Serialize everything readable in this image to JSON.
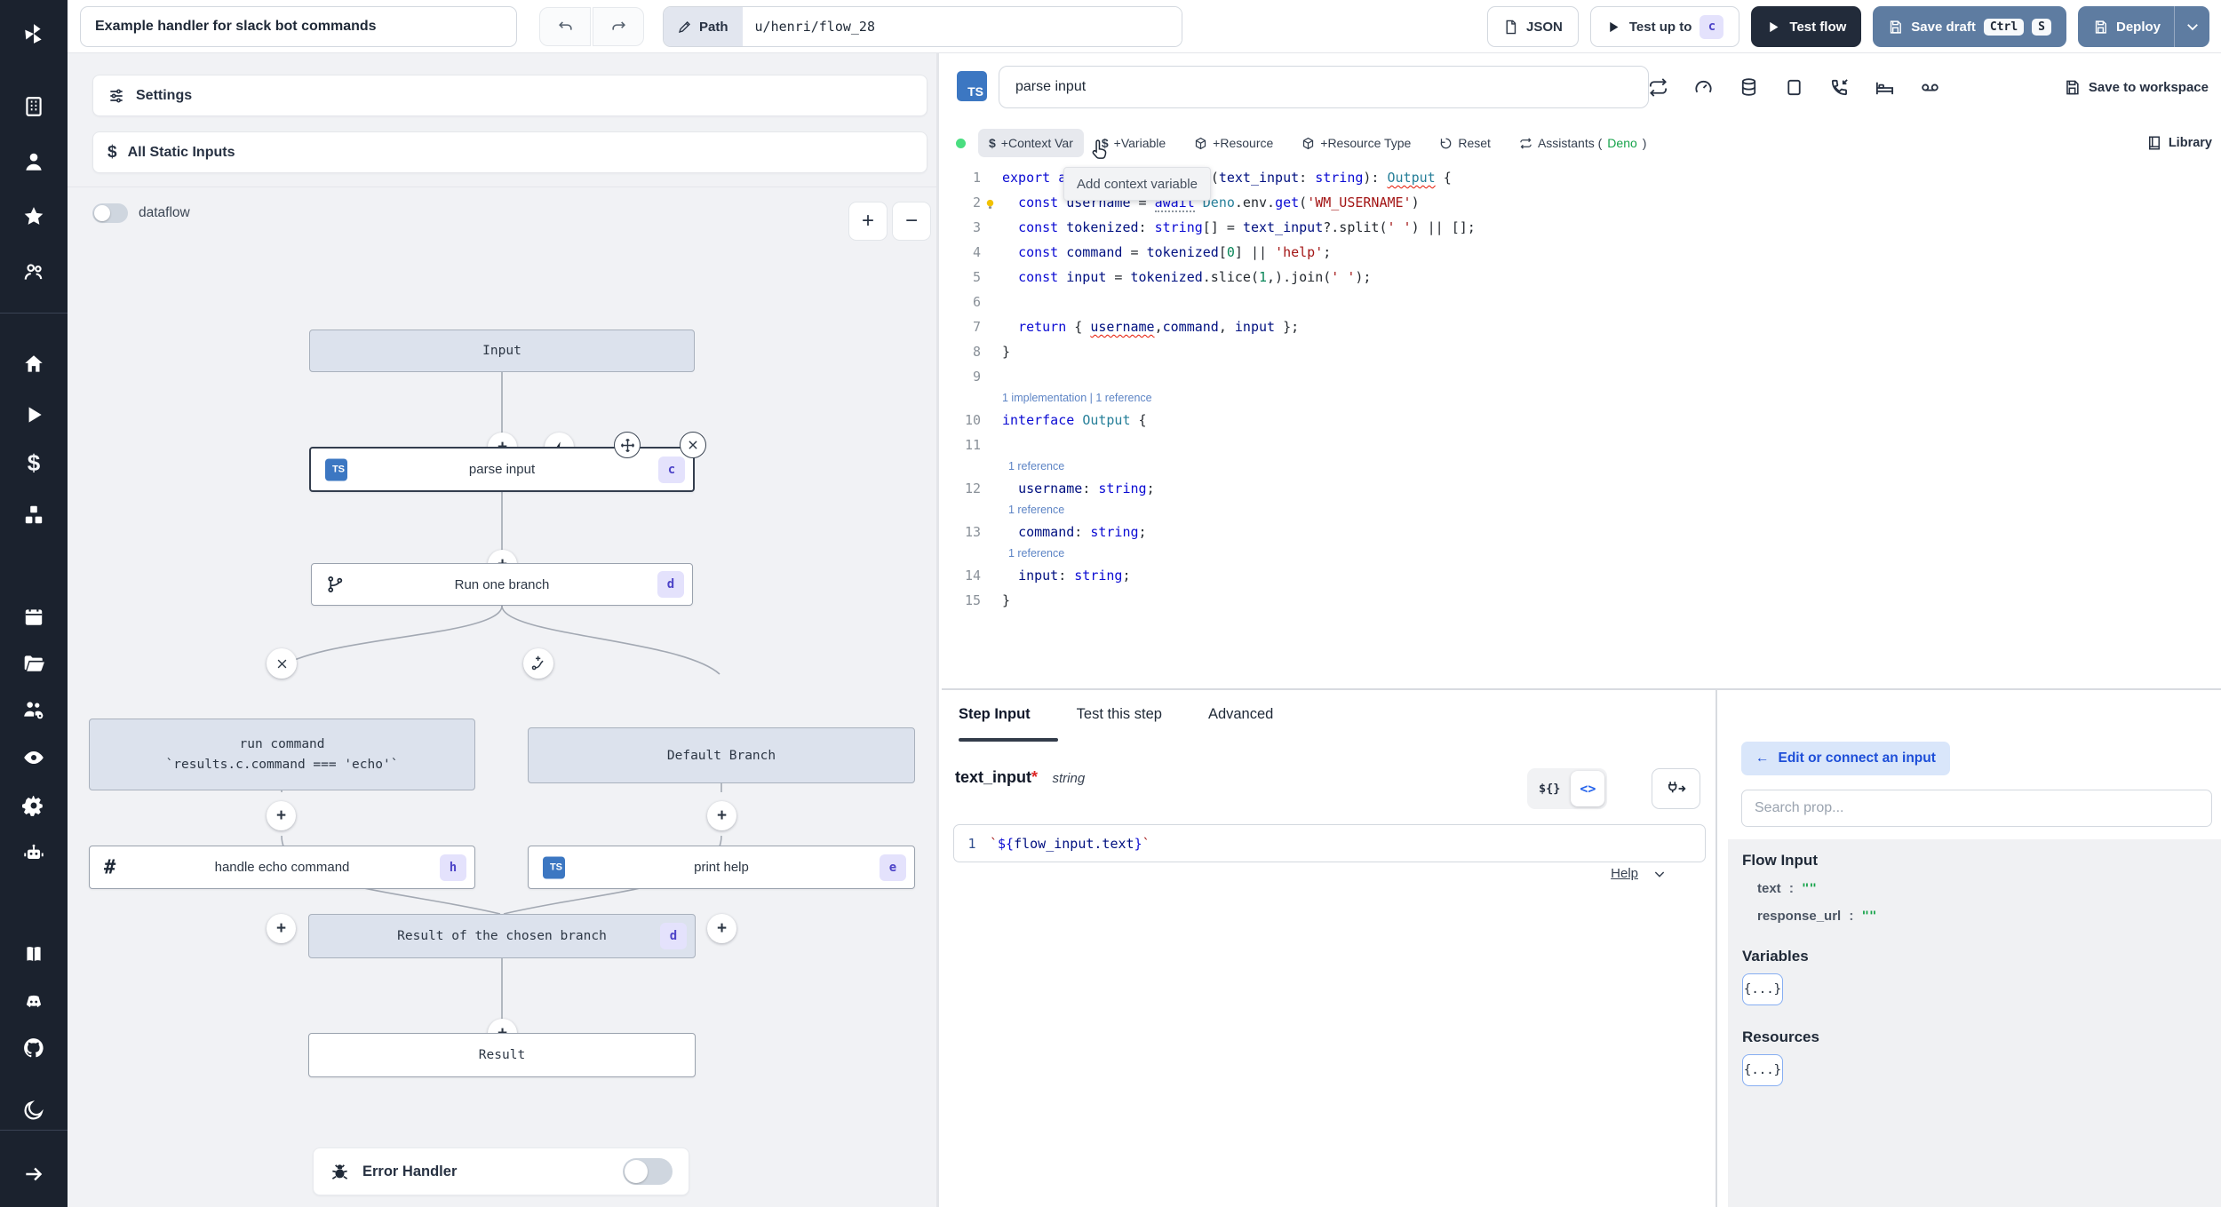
{
  "topbar": {
    "title": "Example handler for slack bot commands",
    "path_label": "Path",
    "path_value": "u/henri/flow_28",
    "json_label": "JSON",
    "test_up_to_label": "Test up to",
    "test_up_to_badge": "c",
    "test_flow_label": "Test flow",
    "save_draft_label": "Save draft",
    "save_draft_kbd_ctrl": "Ctrl",
    "save_draft_kbd_s": "S",
    "deploy_label": "Deploy"
  },
  "sidebar": {
    "icon_names": [
      "windmill-logo",
      "building",
      "user",
      "star",
      "users",
      "home",
      "play",
      "dollar",
      "cubes",
      "calendar",
      "folder",
      "users-gear",
      "eye",
      "gear",
      "robot",
      "book",
      "discord",
      "github",
      "moon",
      "arrow-right"
    ]
  },
  "flow": {
    "settings_label": "Settings",
    "all_static_inputs_label": "All Static Inputs",
    "dataflow_label": "dataflow",
    "zoom_in_label": "+",
    "zoom_out_label": "−",
    "nodes": {
      "input": {
        "label": "Input"
      },
      "parse_input": {
        "label": "parse input",
        "badge": "c"
      },
      "run_one_branch": {
        "label": "Run one branch",
        "badge": "d"
      },
      "run_command": {
        "label_line1": "run command",
        "label_line2": "`results.c.command === 'echo'`"
      },
      "default_branch": {
        "label": "Default Branch"
      },
      "handle_echo": {
        "label": "handle echo command",
        "badge": "h"
      },
      "print_help": {
        "label": "print help",
        "badge": "e"
      },
      "result_branch": {
        "label": "Result of the chosen branch",
        "badge": "d"
      },
      "result": {
        "label": "Result"
      }
    },
    "error_handler_label": "Error Handler"
  },
  "editor": {
    "lang_badge": "TS",
    "step_name": "parse input",
    "save_to_workspace_label": "Save to workspace",
    "toolbar": {
      "context_var": "+Context Var",
      "variable": "+Variable",
      "resource": "+Resource",
      "resource_type": "+Resource Type",
      "reset": "Reset",
      "assistants_prefix": "Assistants (",
      "assistants_lang": "Deno",
      "assistants_suffix": ")",
      "library": "Library"
    },
    "tooltip": "Add context variable",
    "code": {
      "lines": [
        {
          "type": "code",
          "n": "1",
          "tokens": [
            [
              "tk-k",
              "export async function "
            ],
            [
              "tk-m",
              "main"
            ],
            [
              "tk-p",
              "("
            ],
            [
              "tk-v",
              "text_input"
            ],
            [
              "tk-p",
              ": "
            ],
            [
              "tk-k",
              "string"
            ],
            [
              "tk-p",
              "): "
            ],
            [
              "tk-t sq",
              "Output"
            ],
            [
              "tk-p",
              " {"
            ]
          ]
        },
        {
          "type": "code",
          "n": "2",
          "tokens": [
            [
              "tk-p",
              "  "
            ],
            [
              "tk-k",
              "const "
            ],
            [
              "tk-v",
              "username"
            ],
            [
              "tk-p",
              " = "
            ],
            [
              "tk-k hint",
              "await"
            ],
            [
              "tk-p",
              " "
            ],
            [
              "tk-t",
              "Deno"
            ],
            [
              "tk-p",
              ".env."
            ],
            [
              "tk-k",
              "get"
            ],
            [
              "tk-p",
              "("
            ],
            [
              "tk-s",
              "'WM_USERNAME'"
            ],
            [
              "tk-p",
              ")"
            ]
          ]
        },
        {
          "type": "code",
          "n": "3",
          "tokens": [
            [
              "tk-p",
              "  "
            ],
            [
              "tk-k",
              "const "
            ],
            [
              "tk-v",
              "tokenized"
            ],
            [
              "tk-p",
              ": "
            ],
            [
              "tk-k",
              "string"
            ],
            [
              "tk-p",
              "[] = "
            ],
            [
              "tk-v",
              "text_input"
            ],
            [
              "tk-p",
              "?.split("
            ],
            [
              "tk-s",
              "' '"
            ],
            [
              "tk-p",
              ") || [];"
            ]
          ]
        },
        {
          "type": "code",
          "n": "4",
          "tokens": [
            [
              "tk-p",
              "  "
            ],
            [
              "tk-k",
              "const "
            ],
            [
              "tk-v",
              "command"
            ],
            [
              "tk-p",
              " = "
            ],
            [
              "tk-v",
              "tokenized"
            ],
            [
              "tk-p",
              "["
            ],
            [
              "tk-n",
              "0"
            ],
            [
              "tk-p",
              "] || "
            ],
            [
              "tk-s",
              "'help'"
            ],
            [
              "tk-p",
              ";"
            ]
          ]
        },
        {
          "type": "code",
          "n": "5",
          "tokens": [
            [
              "tk-p",
              "  "
            ],
            [
              "tk-k",
              "const "
            ],
            [
              "tk-v",
              "input"
            ],
            [
              "tk-p",
              " = "
            ],
            [
              "tk-v",
              "tokenized"
            ],
            [
              "tk-p",
              ".slice("
            ],
            [
              "tk-n",
              "1"
            ],
            [
              "tk-p",
              ",).join("
            ],
            [
              "tk-s",
              "' '"
            ],
            [
              "tk-p",
              ");"
            ]
          ]
        },
        {
          "type": "code",
          "n": "6",
          "tokens": []
        },
        {
          "type": "code",
          "n": "7",
          "tokens": [
            [
              "tk-p",
              "  "
            ],
            [
              "tk-k",
              "return"
            ],
            [
              "tk-p",
              " { "
            ],
            [
              "tk-v sq",
              "username"
            ],
            [
              "tk-p",
              ","
            ],
            [
              "tk-v",
              "command"
            ],
            [
              "tk-p",
              ", "
            ],
            [
              "tk-v",
              "input"
            ],
            [
              "tk-p",
              " };"
            ]
          ]
        },
        {
          "type": "code",
          "n": "8",
          "tokens": [
            [
              "tk-p",
              "}"
            ]
          ]
        },
        {
          "type": "code",
          "n": "9",
          "tokens": []
        },
        {
          "type": "lens",
          "text": "1 implementation | 1 reference"
        },
        {
          "type": "code",
          "n": "10",
          "tokens": [
            [
              "tk-k",
              "interface "
            ],
            [
              "tk-t",
              "Output"
            ],
            [
              "tk-p",
              " {"
            ]
          ]
        },
        {
          "type": "code",
          "n": "11",
          "tokens": []
        },
        {
          "type": "lens",
          "text": "  1 reference"
        },
        {
          "type": "code",
          "n": "12",
          "tokens": [
            [
              "tk-p",
              "  "
            ],
            [
              "tk-v",
              "username"
            ],
            [
              "tk-p",
              ": "
            ],
            [
              "tk-k",
              "string"
            ],
            [
              "tk-p",
              ";"
            ]
          ]
        },
        {
          "type": "lens",
          "text": "  1 reference"
        },
        {
          "type": "code",
          "n": "13",
          "tokens": [
            [
              "tk-p",
              "  "
            ],
            [
              "tk-v",
              "command"
            ],
            [
              "tk-p",
              ": "
            ],
            [
              "tk-k",
              "string"
            ],
            [
              "tk-p",
              ";"
            ]
          ]
        },
        {
          "type": "lens",
          "text": "  1 reference"
        },
        {
          "type": "code",
          "n": "14",
          "tokens": [
            [
              "tk-p",
              "  "
            ],
            [
              "tk-v",
              "input"
            ],
            [
              "tk-p",
              ": "
            ],
            [
              "tk-k",
              "string"
            ],
            [
              "tk-p",
              ";"
            ]
          ]
        },
        {
          "type": "code",
          "n": "15",
          "tokens": [
            [
              "tk-p",
              "}"
            ]
          ]
        }
      ]
    }
  },
  "step_panel": {
    "tabs": [
      "Step Input",
      "Test this step",
      "Advanced"
    ],
    "field_name": "text_input",
    "required_mark": "*",
    "field_type": "string",
    "toggle_template": "${}",
    "toggle_code": "<>",
    "expr_line_no": "1",
    "expr_tokens": [
      [
        "tk-s",
        "`"
      ],
      [
        "tk-k",
        "${"
      ],
      [
        "tk-v",
        "flow_input.text"
      ],
      [
        "tk-k",
        "}"
      ],
      [
        "tk-s",
        "`"
      ]
    ],
    "help_label": "Help"
  },
  "connect_panel": {
    "edit_button_arrow": "←",
    "edit_button_label": "Edit or connect an input",
    "search_placeholder": "Search prop...",
    "flow_input_title": "Flow Input",
    "rows": [
      {
        "key": "text",
        "colon": ":",
        "value": "\"\""
      },
      {
        "key": "response_url",
        "colon": ":",
        "value": "\"\""
      }
    ],
    "variables_title": "Variables",
    "variables_chip": "{...}",
    "resources_title": "Resources",
    "resources_chip": "{...}"
  },
  "colors": {
    "accent_steel": "#5e7ca1",
    "dark_button": "#222b3a",
    "badge_bg": "#e4e2fc",
    "badge_text": "#4d44c8",
    "ts_blue": "#3c77c2",
    "assistant_green": "#16a34a",
    "status_green": "#4ade80",
    "node_gray": "#dce2ed"
  }
}
